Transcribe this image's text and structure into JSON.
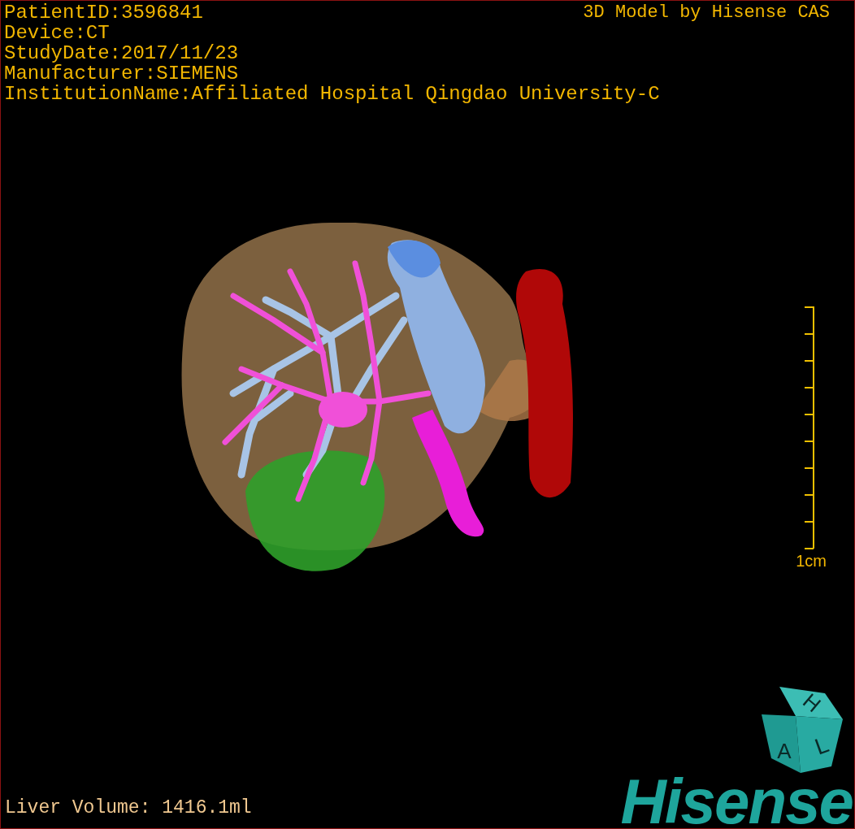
{
  "info_lines": [
    "PatientID:3596841",
    "Device:CT",
    "StudyDate:2017/11/23",
    "Manufacturer:SIEMENS",
    "InstitutionName:Affiliated Hospital Qingdao University-C"
  ],
  "title": "3D Model by Hisense CAS",
  "scale": {
    "label": "1cm"
  },
  "volume": "Liver Volume: 1416.1ml",
  "cube": {
    "letters": [
      "H",
      "A",
      "L"
    ]
  },
  "logo": "Hisense"
}
